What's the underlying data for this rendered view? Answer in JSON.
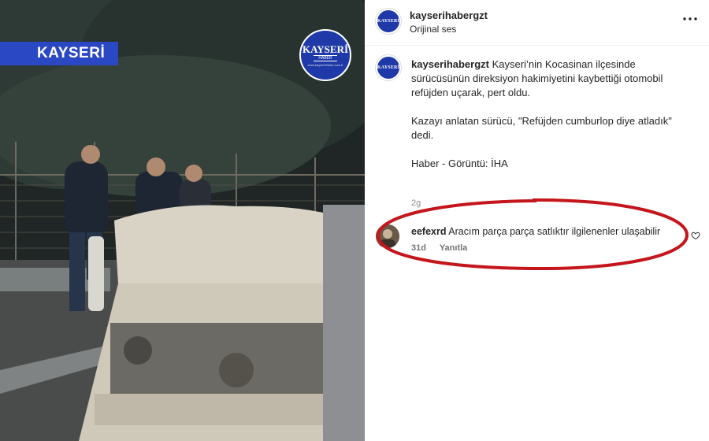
{
  "media": {
    "region_label": "KAYSERİ",
    "logo": {
      "line1": "KAYSERİ",
      "line2": "HABER",
      "line3": "www.kayseriHaber.com.tr"
    }
  },
  "post": {
    "username": "kayserihabergzt",
    "audio": "Orijinal ses",
    "avatar_text": "KAYSERİ",
    "caption_username": "kayserihabergzt",
    "caption_p1": "Kayseri’nin Kocasinan ilçesinde sürücüsünün direksiyon hakimiyetini kaybettiği otomobil refüjden uçarak, pert oldu.",
    "caption_p2": "Kazayı anlatan sürücü, \"Refüjden cumburlop diye atladık\" dedi.",
    "caption_p3": "Haber - Görüntü: İHA",
    "time_ago": "2g"
  },
  "comment": {
    "username": "eefexrd",
    "text": "Aracım parça parça satlıktır ilgilenenler ulaşabilir",
    "time": "31d",
    "reply_label": "Yanıtla"
  },
  "icons": {
    "more": "more-horizontal-icon",
    "like": "heart-outline-icon"
  },
  "colors": {
    "banner_blue": "#2a47c4",
    "brand_blue": "#1f3aa8",
    "highlight_red": "#c4161c"
  }
}
